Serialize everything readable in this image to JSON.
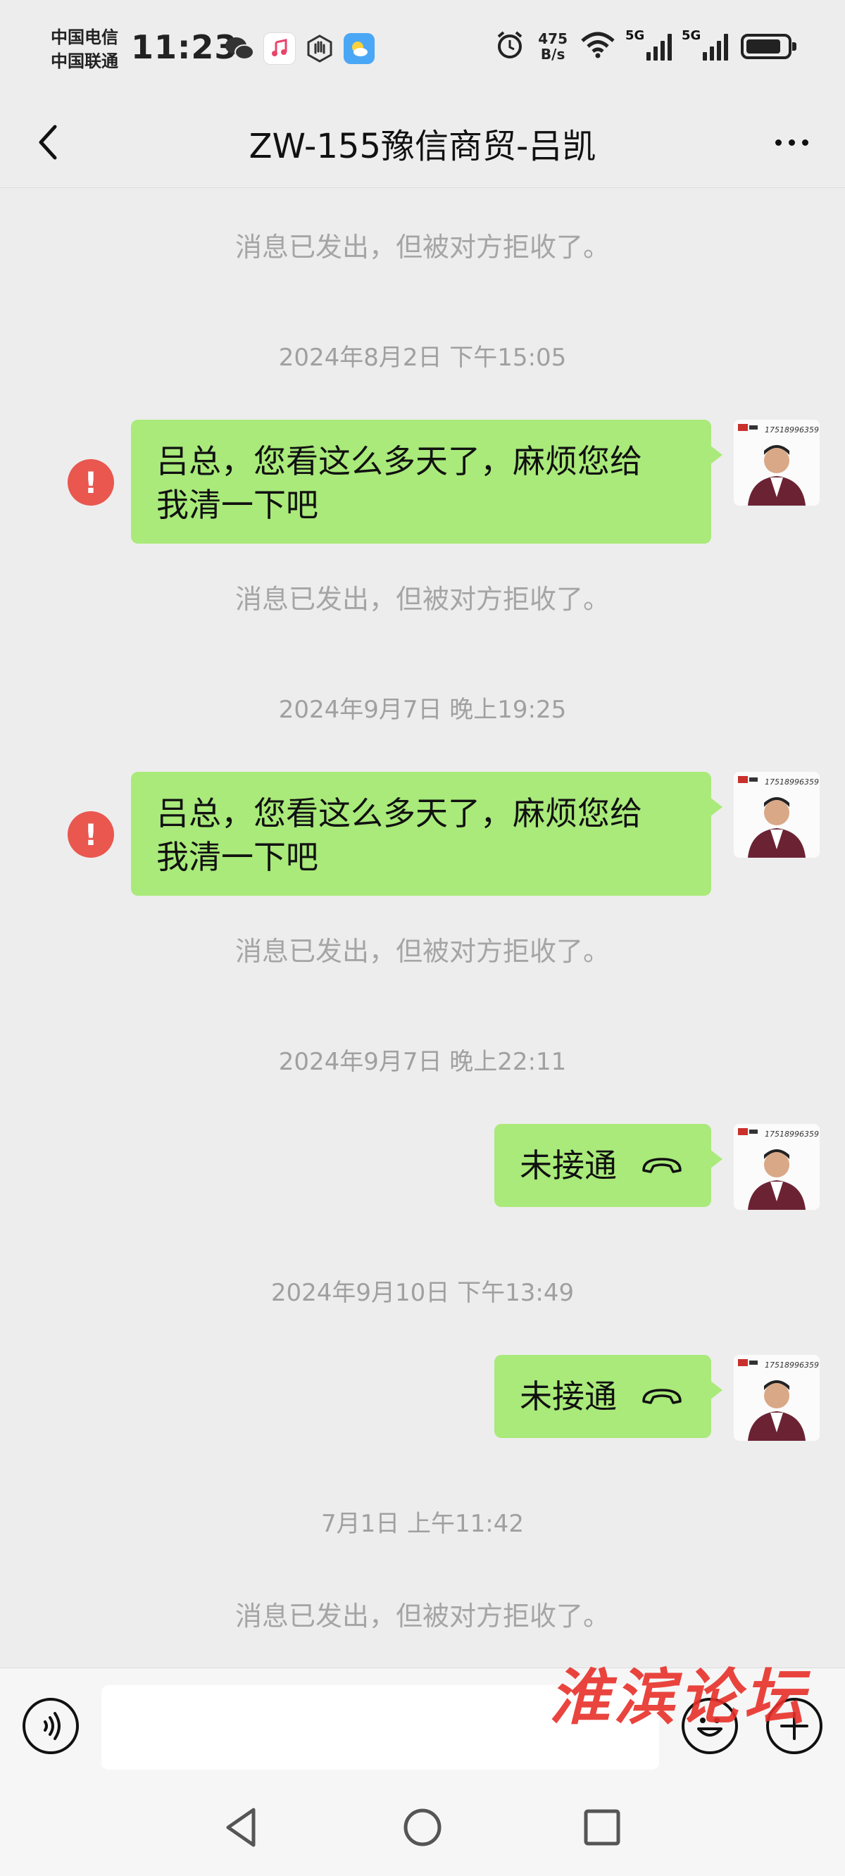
{
  "status_bar": {
    "carrier_1": "中国电信",
    "carrier_2": "中国联通",
    "time": "11:23",
    "net_speed_value": "475",
    "net_speed_unit": "B/s",
    "signal_1_label": "5G",
    "signal_2_label": "5G",
    "notification_icons": [
      "wechat-icon",
      "music-icon",
      "hand-icon",
      "weather-icon"
    ],
    "status_icons": [
      "alarm-icon",
      "wifi-icon",
      "signal-icon",
      "signal-icon",
      "battery-icon"
    ]
  },
  "header": {
    "title": "ZW-155豫信商贸-吕凯",
    "back_icon": "chevron-left-icon",
    "more_icon": "more-dots-icon"
  },
  "messages": {
    "notice_top": "消息已发出，但被对方拒收了。",
    "ts1": "2024年8月2日 下午15:05",
    "msg1_line1": "吕总，您看这么多天了，麻烦您给",
    "msg1_line2": "我清一下吧",
    "notice1": "消息已发出，但被对方拒收了。",
    "ts2": "2024年9月7日 晚上19:25",
    "msg2_line1": "吕总，您看这么多天了，麻烦您给",
    "msg2_line2": "我清一下吧",
    "notice2": "消息已发出，但被对方拒收了。",
    "ts3": "2024年9月7日 晚上22:11",
    "call1": "未接通",
    "ts4": "2024年9月10日 下午13:49",
    "call2": "未接通",
    "ts5": "7月1日 上午11:42",
    "notice3": "消息已发出，但被对方拒收了。",
    "error_glyph": "!",
    "avatar_phone": "17518996359"
  },
  "input_bar": {
    "input_value": "",
    "watermark": "淮滨论坛"
  },
  "colors": {
    "background": "#ededed",
    "bubble_green": "#a9ea7a",
    "error_red": "#e9574f",
    "watermark_red": "#e8302a",
    "notice_gray": "#a5a5a5"
  }
}
